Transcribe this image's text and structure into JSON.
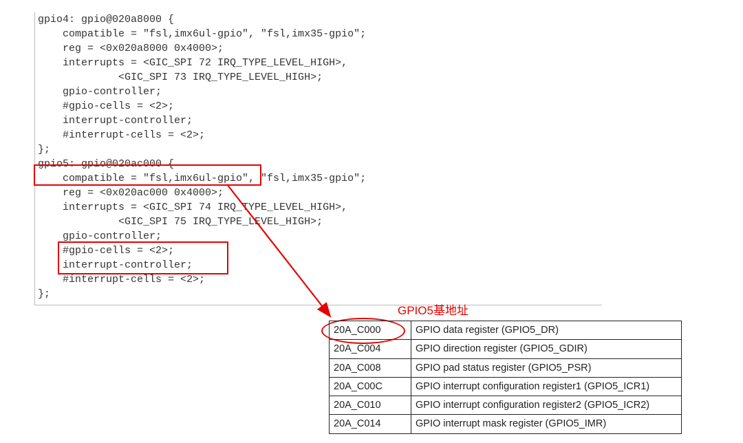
{
  "code": {
    "lines": [
      "gpio4: gpio@020a8000 {",
      "    compatible = \"fsl,imx6ul-gpio\", \"fsl,imx35-gpio\";",
      "    reg = <0x020a8000 0x4000>;",
      "    interrupts = <GIC_SPI 72 IRQ_TYPE_LEVEL_HIGH>,",
      "             <GIC_SPI 73 IRQ_TYPE_LEVEL_HIGH>;",
      "    gpio-controller;",
      "    #gpio-cells = <2>;",
      "    interrupt-controller;",
      "    #interrupt-cells = <2>;",
      "};",
      "",
      "gpio5: gpio@020ac000 {",
      "    compatible = \"fsl,imx6ul-gpio\", \"fsl,imx35-gpio\";",
      "    reg = <0x020ac000 0x4000>;",
      "    interrupts = <GIC_SPI 74 IRQ_TYPE_LEVEL_HIGH>,",
      "             <GIC_SPI 75 IRQ_TYPE_LEVEL_HIGH>;",
      "    gpio-controller;",
      "    #gpio-cells = <2>;",
      "    interrupt-controller;",
      "    #interrupt-cells = <2>;",
      "};"
    ]
  },
  "annotation": {
    "label": "GPIO5基地址"
  },
  "table": {
    "rows": [
      {
        "addr": "20A_C000",
        "name": "GPIO data register (GPIO5_DR)"
      },
      {
        "addr": "20A_C004",
        "name": "GPIO direction register (GPIO5_GDIR)"
      },
      {
        "addr": "20A_C008",
        "name": "GPIO pad status register (GPIO5_PSR)"
      },
      {
        "addr": "20A_C00C",
        "name": "GPIO interrupt configuration register1 (GPIO5_ICR1)"
      },
      {
        "addr": "20A_C010",
        "name": "GPIO interrupt configuration register2 (GPIO5_ICR2)"
      },
      {
        "addr": "20A_C014",
        "name": "GPIO interrupt mask register (GPIO5_IMR)"
      }
    ]
  }
}
